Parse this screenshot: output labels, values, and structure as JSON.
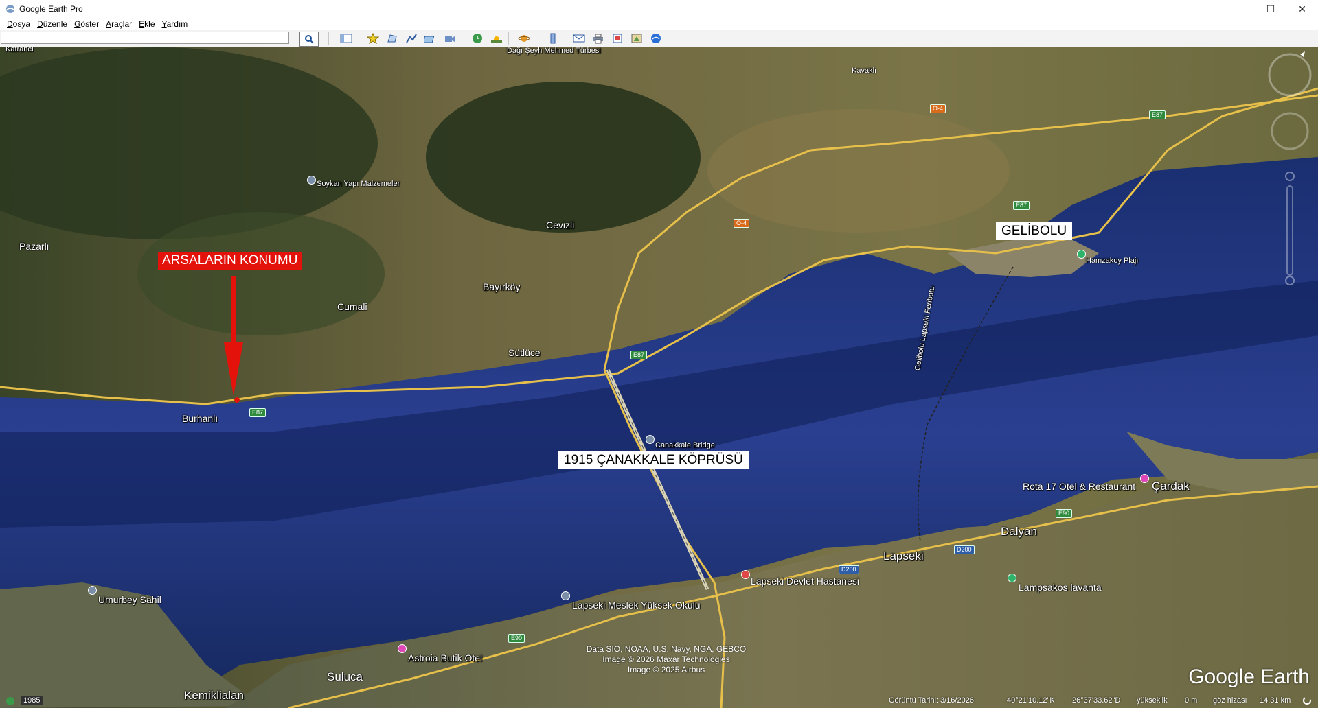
{
  "window": {
    "title": "Google Earth Pro",
    "minimize": "—",
    "maximize": "☐",
    "close": "✕"
  },
  "menu": [
    "Dosya",
    "Düzenle",
    "Göster",
    "Araçlar",
    "Ekle",
    "Yardım"
  ],
  "search": {
    "value": "",
    "placeholder": ""
  },
  "toolbar": {
    "icons": [
      "search-icon",
      "sidebar-toggle-icon",
      "placemark-icon",
      "polygon-icon",
      "path-icon",
      "image-overlay-icon",
      "record-tour-icon",
      "historical-imagery-icon",
      "sunlight-icon",
      "planets-icon",
      "ruler-icon",
      "email-icon",
      "print-icon",
      "save-image-icon",
      "view-in-maps-icon",
      "google-earth-icon"
    ]
  },
  "map_labels": {
    "katranci": "Katrancı",
    "dagi_turbe": "Dağı Şeyh Mehmed Türbesi",
    "kavakli": "Kavaklı",
    "soykan": "Soykan Yapı Malzemeler",
    "cevizli": "Cevizli",
    "pazarli": "Pazarlı",
    "cumali": "Cumali",
    "bayirkoy": "Bayırköy",
    "sutluce": "Sütlüce",
    "burhanli": "Burhanlı",
    "hamzakoy": "Hamzakoy Plajı",
    "canakkale_bridge": "Canakkale Bridge",
    "ferry": "Gelibolu Lapseki Feribotu",
    "rota17": "Rota 17 Otel & Restaurant",
    "cardak": "Çardak",
    "dalyan": "Dalyan",
    "lapseki": "Lapseki",
    "hastane": "Lapseki Devlet Hastanesi",
    "lavanta": "Lampsakos lavanta",
    "meslek": "Lapseki Meslek Yüksek Okulu",
    "umurbey": "Umurbey Sahil",
    "astroia": "Astroia Butik Otel",
    "suluca": "Suluca",
    "kemiklialan": "Kemiklialan"
  },
  "road_shields": {
    "e87_a": "E87",
    "e87_b": "E87",
    "e87_c": "E87",
    "e87_d": "E87",
    "o4_a": "O-4",
    "o4_b": "O-4",
    "e90_a": "E90",
    "e90_b": "E90",
    "d200_a": "D200",
    "d200_b": "D200"
  },
  "overlays": {
    "arsa": "ARSALARIN KONUMU",
    "gelibolu": "GELİBOLU",
    "kopru": "1915 ÇANAKKALE KÖPRÜSÜ"
  },
  "attribution": [
    "Data SIO, NOAA, U.S. Navy, NGA, GEBCO",
    "Image © 2026 Maxar Technologies",
    "Image © 2025 Airbus"
  ],
  "watermark": "Google Earth",
  "status": {
    "year": "1985",
    "date": "Görüntü Tarihi: 3/16/2026",
    "lat": "40°21'10.12\"K",
    "lon": "26°37'33.62\"D",
    "elev_label": "yükseklik",
    "elev": "0 m",
    "eye_label": "göz hizası",
    "eye": "14.31 km"
  },
  "colors": {
    "sea": "#1e3b86",
    "sea_deep": "#0f1f4f",
    "land": "#6b6a3e",
    "forest": "#2e3a1f",
    "road": "#e6c04a",
    "red": "#e3120b"
  }
}
